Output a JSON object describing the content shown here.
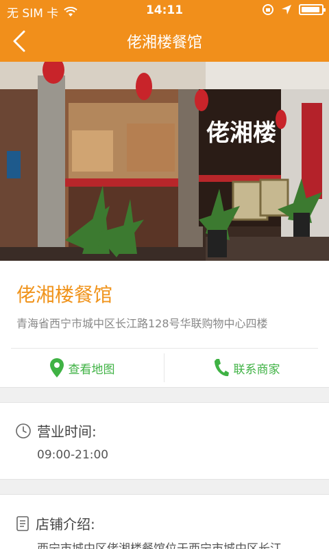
{
  "status_bar": {
    "carrier": "无 SIM 卡",
    "time": "14:11"
  },
  "nav": {
    "title": "佬湘楼餐馆"
  },
  "hero": {
    "sign_text": "佬湘楼"
  },
  "shop": {
    "name": "佬湘楼餐馆",
    "address": "青海省西宁市城中区长江路128号华联购物中心四楼"
  },
  "actions": {
    "map_label": "查看地图",
    "contact_label": "联系商家"
  },
  "hours": {
    "title": "营业时间:",
    "value": "09:00-21:00"
  },
  "intro": {
    "title": "店铺介绍:",
    "text": "西宁市城中区佬湘楼餐馆位于西宁市城中区长江"
  },
  "colors": {
    "accent": "#f18f1b",
    "shop_name": "#f0941d",
    "action_green": "#3fb244"
  }
}
